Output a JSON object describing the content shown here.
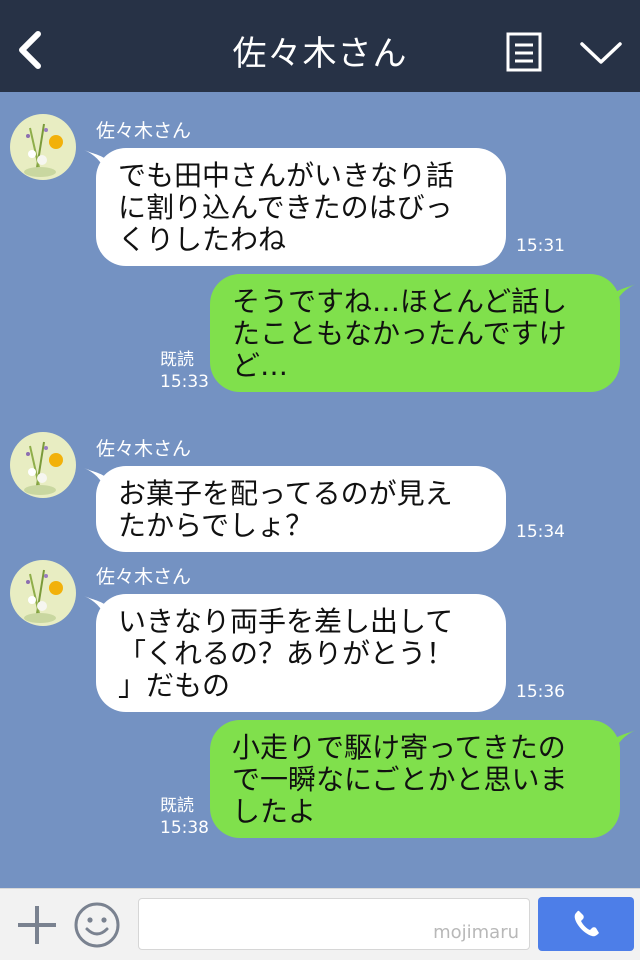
{
  "header": {
    "title": "佐々木さん",
    "back_icon": "chevron-left-icon",
    "menu_icon": "note-list-icon",
    "collapse_icon": "chevron-down-icon"
  },
  "messages": [
    {
      "direction": "incoming",
      "sender": "佐々木さん",
      "lines": [
        "でも田中さんがいきなり話",
        "に割り込んできたのはびっ",
        "くりしたわね"
      ],
      "time": "15:31"
    },
    {
      "direction": "outgoing",
      "read_label": "既読",
      "lines": [
        "そうですね…ほとんど話し",
        "たこともなかったんですけ",
        "ど…"
      ],
      "time": "15:33"
    },
    {
      "direction": "incoming",
      "sender": "佐々木さん",
      "lines": [
        "お菓子を配ってるのが見え",
        "たからでしょ？"
      ],
      "time": "15:34"
    },
    {
      "direction": "incoming",
      "sender": "佐々木さん",
      "lines": [
        "いきなり両手を差し出して",
        "「くれるの？ありがとう！",
        "」だもの"
      ],
      "time": "15:36"
    },
    {
      "direction": "outgoing",
      "read_label": "既読",
      "lines": [
        "小走りで駆け寄ってきたの",
        "で一瞬なにごとかと思いま",
        "したよ"
      ],
      "time": "15:38"
    }
  ],
  "input_bar": {
    "watermark": "mojimaru",
    "plus_icon": "plus-icon",
    "emoji_icon": "smiley-icon",
    "call_icon": "phone-icon"
  },
  "colors": {
    "header_bg": "#273246",
    "chat_bg": "#7492c2",
    "incoming_bubble": "#ffffff",
    "outgoing_bubble": "#80e04c",
    "call_button": "#4d7ee8"
  }
}
